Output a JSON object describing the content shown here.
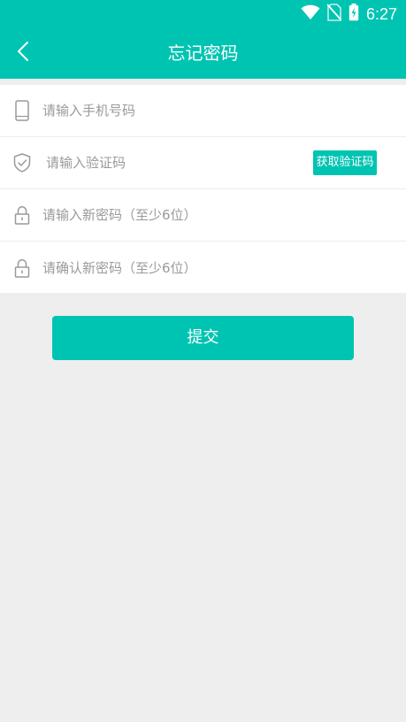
{
  "status_bar": {
    "time": "6:27",
    "icons": [
      "wifi-icon",
      "no-sim-icon",
      "battery-charging-icon"
    ]
  },
  "app_bar": {
    "title": "忘记密码",
    "back_icon": "back-arrow-icon"
  },
  "form": {
    "phone": {
      "icon": "phone-icon",
      "placeholder": "请输入手机号码",
      "value": ""
    },
    "code": {
      "icon": "shield-check-icon",
      "placeholder": "请输入验证码",
      "value": "",
      "button_label": "获取验证码"
    },
    "new_password": {
      "icon": "lock-icon",
      "placeholder": "请输入新密码（至少6位）",
      "value": ""
    },
    "confirm_password": {
      "icon": "lock-icon",
      "placeholder": "请确认新密码（至少6位）",
      "value": ""
    }
  },
  "submit": {
    "label": "提交"
  },
  "colors": {
    "accent": "#00c4b2",
    "page_background": "#eeeeee",
    "placeholder": "#9a9a9a"
  }
}
